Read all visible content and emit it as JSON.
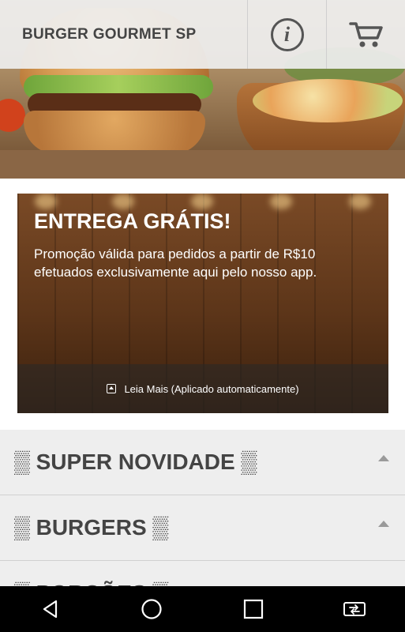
{
  "app": {
    "brand": "BURGER GOURMET SP"
  },
  "header": {
    "info_icon": "info-icon",
    "cart_icon": "cart-icon"
  },
  "promo": {
    "title": "ENTREGA GRÁTIS!",
    "description": "Promoção válida para pedidos a partir de R$10 efetuados exclusivamente aqui pelo nosso app.",
    "footer_label": "Leia Mais (Aplicado automaticamente)"
  },
  "categories": [
    {
      "label": "▒ SUPER NOVIDADE ▒"
    },
    {
      "label": "▒ BURGERS ▒"
    },
    {
      "label": "▒ PORÇÕES ▒"
    }
  ],
  "system_nav": {
    "icons": [
      "back-icon",
      "home-icon",
      "recents-icon",
      "screen-rotate-icon"
    ]
  }
}
